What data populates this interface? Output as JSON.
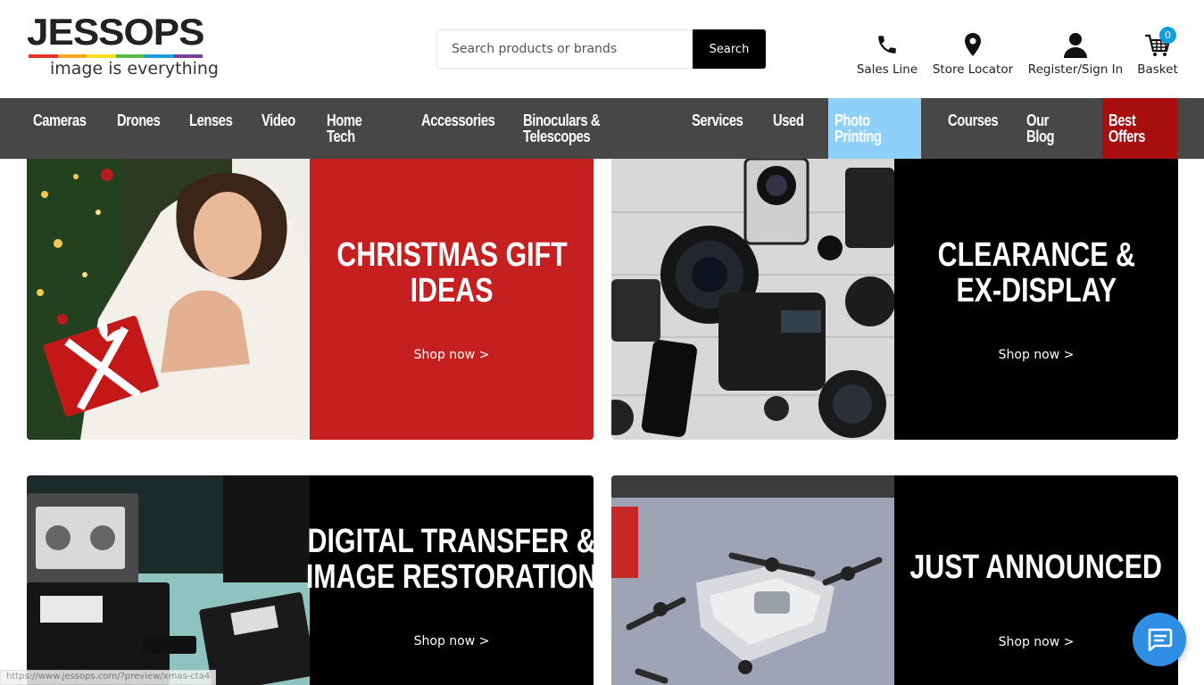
{
  "brand": {
    "name": "JESSOPS",
    "tagline": "image is everything",
    "stripe_colors": [
      "#e4312b",
      "#f7a823",
      "#f4e01b",
      "#5bb947",
      "#1a9fdb",
      "#7b3f98"
    ]
  },
  "search": {
    "placeholder": "Search products or brands",
    "button_label": "Search"
  },
  "header_links": {
    "sales_line": "Sales Line",
    "store_locator": "Store Locator",
    "register": "Register/Sign In",
    "basket": "Basket",
    "basket_count": "0"
  },
  "nav": {
    "cameras": "Cameras",
    "drones": "Drones",
    "lenses": "Lenses",
    "video": "Video",
    "home_tech_1": "Home",
    "home_tech_2": "Tech",
    "accessories": "Accessories",
    "binoculars_1": "Binoculars &",
    "binoculars_2": "Telescopes",
    "services": "Services",
    "used": "Used",
    "photo_1": "Photo",
    "photo_2": "Printing",
    "courses": "Courses",
    "blog_1": "Our",
    "blog_2": "Blog",
    "offers_1": "Best",
    "offers_2": "Offers"
  },
  "promos": {
    "christmas": {
      "title_1": "CHRISTMAS GIFT",
      "title_2": "IDEAS",
      "cta": "Shop now >",
      "panel_color": "#c61f1f"
    },
    "clearance": {
      "title_1": "CLEARANCE &",
      "title_2": "EX-DISPLAY",
      "cta": "Shop now >",
      "panel_color": "#000000"
    },
    "transfer": {
      "title_1": "DIGITAL TRANSFER &",
      "title_2": "IMAGE RESTORATION",
      "cta": "Shop now >",
      "panel_color": "#000000"
    },
    "announced": {
      "title_1": "JUST ANNOUNCED",
      "cta": "Shop now >",
      "panel_color": "#000000"
    }
  },
  "status_url": "https://www.jessops.com/?preview/xmas-cta4",
  "icons": {
    "phone": "phone-icon",
    "location": "map-pin-icon",
    "user": "user-icon",
    "basket": "basket-icon",
    "chat": "chat-icon"
  }
}
